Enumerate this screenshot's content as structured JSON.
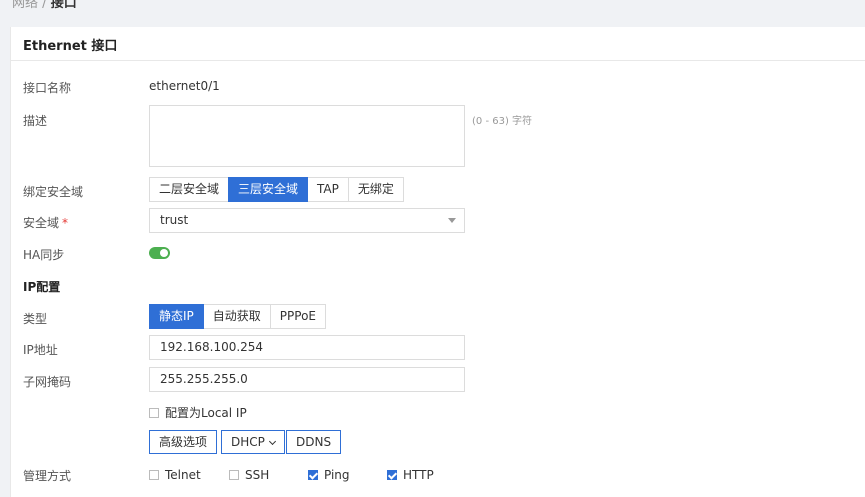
{
  "breadcrumb": {
    "parent": "网络",
    "separator": "/",
    "current": "接口"
  },
  "card": {
    "title": "Ethernet 接口"
  },
  "interface_name": {
    "label": "接口名称",
    "value": "ethernet0/1"
  },
  "description": {
    "label": "描述",
    "value": "",
    "hint": "(0 - 63) 字符"
  },
  "bind_zone": {
    "label": "绑定安全域",
    "options": [
      "二层安全域",
      "三层安全域",
      "TAP",
      "无绑定"
    ],
    "selected": "三层安全域"
  },
  "security_zone": {
    "label": "安全域",
    "required_mark": "*",
    "value": "trust"
  },
  "ha_sync": {
    "label": "HA同步",
    "enabled": true
  },
  "ip_config": {
    "section_label": "IP配置",
    "type_label": "类型",
    "type_options": [
      "静态IP",
      "自动获取",
      "PPPoE"
    ],
    "type_selected": "静态IP",
    "ip_label": "IP地址",
    "ip_value": "192.168.100.254",
    "mask_label": "子网掩码",
    "mask_value": "255.255.255.0",
    "local_ip_label": "配置为Local IP",
    "local_ip_checked": false
  },
  "actions": {
    "advanced": "高级选项",
    "dhcp": "DHCP",
    "ddns": "DDNS"
  },
  "management": {
    "label": "管理方式",
    "options": [
      {
        "label": "Telnet",
        "checked": false
      },
      {
        "label": "SSH",
        "checked": false
      },
      {
        "label": "Ping",
        "checked": true
      },
      {
        "label": "HTTP",
        "checked": true
      }
    ]
  },
  "colors": {
    "accent": "#2f6fd6",
    "toggle_on": "#4caf50",
    "required": "#e53935"
  }
}
